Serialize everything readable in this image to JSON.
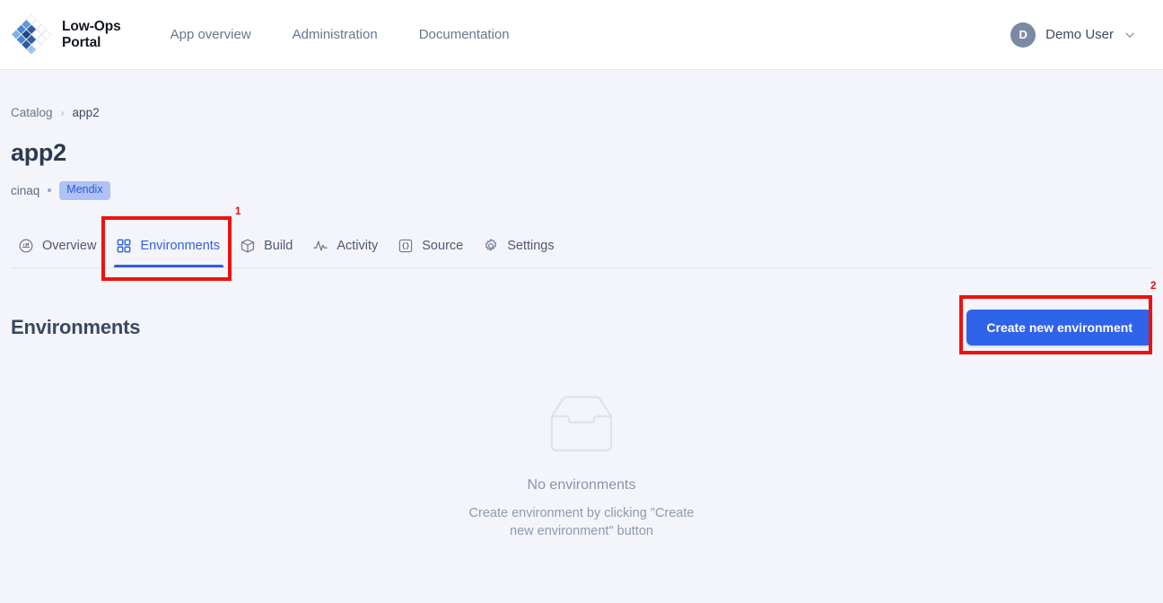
{
  "header": {
    "brand": {
      "name": "Low-Ops\nPortal",
      "logo_icon": "diamond-grid-logo",
      "logo_colors": [
        "#2f5fa8",
        "#4a86d6",
        "#7fb0e6",
        "#c9dcf2"
      ]
    },
    "nav": [
      {
        "label": "App overview",
        "name": "nav-app-overview"
      },
      {
        "label": "Administration",
        "name": "nav-administration"
      },
      {
        "label": "Documentation",
        "name": "nav-documentation"
      }
    ],
    "user": {
      "initial": "D",
      "name": "Demo User",
      "chevron_icon": "chevron-down-icon"
    }
  },
  "breadcrumb": {
    "items": [
      {
        "label": "Catalog"
      },
      {
        "label": "app2"
      }
    ],
    "separator": "›"
  },
  "app": {
    "title": "app2",
    "owner": "cinaq",
    "badge": "Mendix"
  },
  "tabs": [
    {
      "label": "Overview",
      "icon": "gauge-icon",
      "active": false
    },
    {
      "label": "Environments",
      "icon": "grid-2x2-icon",
      "active": true
    },
    {
      "label": "Build",
      "icon": "box-icon",
      "active": false
    },
    {
      "label": "Activity",
      "icon": "activity-pulse-icon",
      "active": false
    },
    {
      "label": "Source",
      "icon": "curly-braces-icon",
      "active": false
    },
    {
      "label": "Settings",
      "icon": "gear-icon",
      "active": false
    }
  ],
  "section": {
    "title": "Environments",
    "create_button": "Create new environment"
  },
  "empty_state": {
    "icon": "inbox-tray-icon",
    "title": "No environments",
    "subtitle": "Create environment by clicking \"Create new environment\" button"
  },
  "annotations": [
    {
      "number": "1",
      "target": "environments-tab"
    },
    {
      "number": "2",
      "target": "create-new-environment-button"
    }
  ],
  "colors": {
    "accent": "#2f63ea",
    "page_bg": "#f4f5fa",
    "annotation": "#ee1111",
    "badge_bg": "#aec2f7",
    "badge_text": "#2f5bd0"
  }
}
